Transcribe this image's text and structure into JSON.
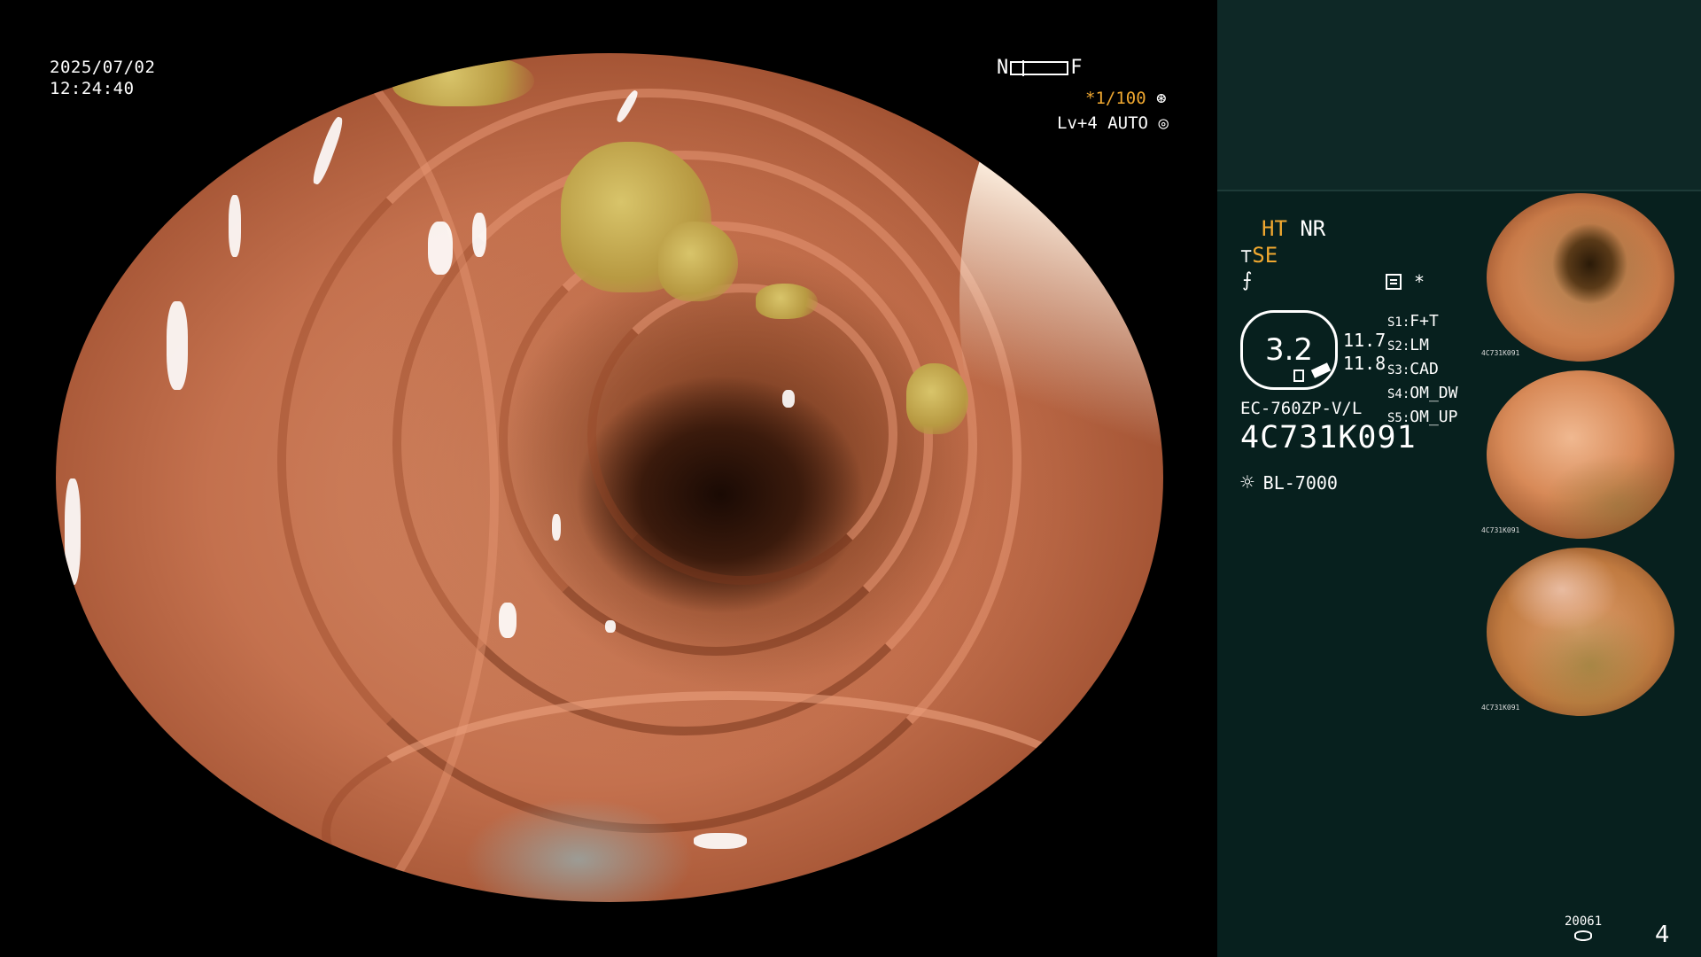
{
  "overlay": {
    "date": "2025/07/02",
    "time": "12:24:40",
    "near_label": "N",
    "far_label": "F",
    "shutter_speed": "*1/100",
    "shutter_icon": "⊛",
    "level": "Lv+4",
    "auto_label": "AUTO",
    "auto_icon": "◎"
  },
  "panel": {
    "ht_label": "HT",
    "nr_label": "NR",
    "se_icon": "⊤",
    "se_label": "SE",
    "slash_icon": "⨍",
    "memo_star": "*",
    "gauge_value": "3.2",
    "gauge_top_value": "11.7",
    "gauge_bottom_value": "11.8",
    "settings": [
      {
        "key": "S1:",
        "value": "F+T"
      },
      {
        "key": "S2:",
        "value": "LM"
      },
      {
        "key": "S3:",
        "value": "CAD"
      },
      {
        "key": "S4:",
        "value": "OM_DW"
      },
      {
        "key": "S5:",
        "value": "OM_UP"
      }
    ],
    "model": "EC-760ZP-V/L",
    "serial": "4C731K091",
    "light_icon": "☼",
    "light_source": "BL-7000"
  },
  "thumbnails": [
    {
      "label": "4C731K091"
    },
    {
      "label": "4C731K091"
    },
    {
      "label": "4C731K091"
    }
  ],
  "footer": {
    "image_count": "20061",
    "page_number": "4"
  }
}
